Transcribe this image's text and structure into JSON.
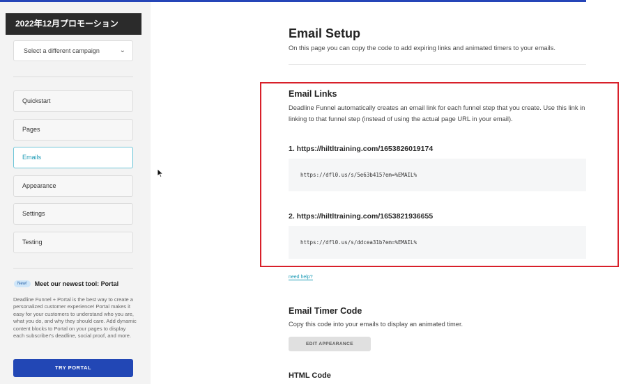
{
  "sidebar": {
    "campaign_title": "2022年12月プロモーション",
    "campaign_select": "Select a different campaign",
    "nav": [
      "Quickstart",
      "Pages",
      "Emails",
      "Appearance",
      "Settings",
      "Testing"
    ],
    "active_nav": "Emails",
    "promo": {
      "badge": "New!",
      "title": "Meet our newest tool: Portal",
      "text": "Deadline Funnel + Portal is the best way to create a personalized customer experience! Portal makes it easy for your customers to understand who you are, what you do, and why they should care. Add dynamic content blocks to Portal on your pages to display each subscriber's deadline, social proof, and more.",
      "button": "TRY PORTAL"
    }
  },
  "main": {
    "title": "Email Setup",
    "description": "On this page you can copy the code to add expiring links and animated timers to your emails.",
    "email_links": {
      "title": "Email Links",
      "description": "Deadline Funnel automatically creates an email link for each funnel step that you create. Use this link in linking to that funnel step (instead of using the actual page URL in your email).",
      "links": [
        {
          "label": "1. https://hiltltraining.com/1653826019174",
          "code": "https://dfl0.us/s/5e63b415?em=%EMAIL%"
        },
        {
          "label": "2. https://hiltltraining.com/1653821936655",
          "code": "https://dfl0.us/s/ddcea31b?em=%EMAIL%"
        }
      ],
      "help_link": "need help?"
    },
    "timer": {
      "title": "Email Timer Code",
      "description": "Copy this code into your emails to display an animated timer.",
      "button": "EDIT APPEARANCE"
    },
    "html_code_title": "HTML Code"
  },
  "colors": {
    "accent_blue": "#2247b5",
    "active_teal": "#1a9ab5",
    "highlight_red": "#d8202a"
  }
}
